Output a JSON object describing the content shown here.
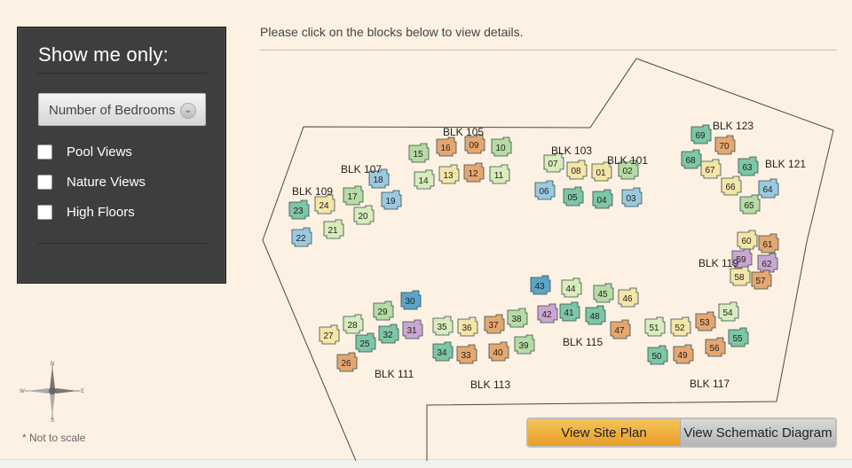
{
  "filters": {
    "title": "Show me only:",
    "dropdown_label": "Number of Bedrooms",
    "options": [
      "Pool Views",
      "Nature Views",
      "High Floors"
    ]
  },
  "instruction": "Please click on the blocks below to view details.",
  "note": "* Not to scale",
  "compass": {
    "n": "N",
    "s": "S",
    "e": "E",
    "w": "W"
  },
  "buttons": {
    "site_plan": "View Site Plan",
    "schematic": "View Schematic Diagram"
  },
  "colors": {
    "green": "#b6dca4",
    "teal": "#7dc6a6",
    "yellow": "#f5e5a7",
    "lightgreen": "#d9ecbc",
    "blue": "#9bc9e0",
    "orange": "#e5a76f",
    "purple": "#cca6d2",
    "darkblue": "#5aa6c8",
    "bg": "#fdf1e3"
  },
  "blocks": [
    {
      "label": "BLK 109",
      "units": [
        "23",
        "24",
        "22",
        "21"
      ]
    },
    {
      "label": "BLK 107",
      "units": [
        "17",
        "18",
        "20",
        "19"
      ]
    },
    {
      "label": "BLK 105",
      "units": [
        "15",
        "16",
        "09",
        "10",
        "14",
        "13",
        "12",
        "11"
      ]
    },
    {
      "label": "BLK 103",
      "units": [
        "07",
        "08",
        "06",
        "05"
      ]
    },
    {
      "label": "BLK 101",
      "units": [
        "01",
        "02",
        "04",
        "03"
      ]
    },
    {
      "label": "BLK 123",
      "units": [
        "69",
        "70",
        "68",
        "67"
      ]
    },
    {
      "label": "BLK 121",
      "units": [
        "63",
        "66",
        "64",
        "65"
      ]
    },
    {
      "label": "BLK 119",
      "units": [
        "60",
        "61",
        "59",
        "62",
        "58",
        "57"
      ]
    },
    {
      "label": "BLK 111",
      "units": [
        "29",
        "30",
        "28",
        "32",
        "31",
        "27",
        "25",
        "26"
      ]
    },
    {
      "label": "BLK 113",
      "units": [
        "35",
        "36",
        "37",
        "38",
        "34",
        "33",
        "40",
        "39"
      ]
    },
    {
      "label": "BLK 115",
      "units": [
        "43",
        "44",
        "45",
        "46",
        "42",
        "41",
        "48",
        "47"
      ]
    },
    {
      "label": "BLK 117",
      "units": [
        "51",
        "52",
        "53",
        "54",
        "50",
        "49",
        "56",
        "55"
      ]
    }
  ]
}
